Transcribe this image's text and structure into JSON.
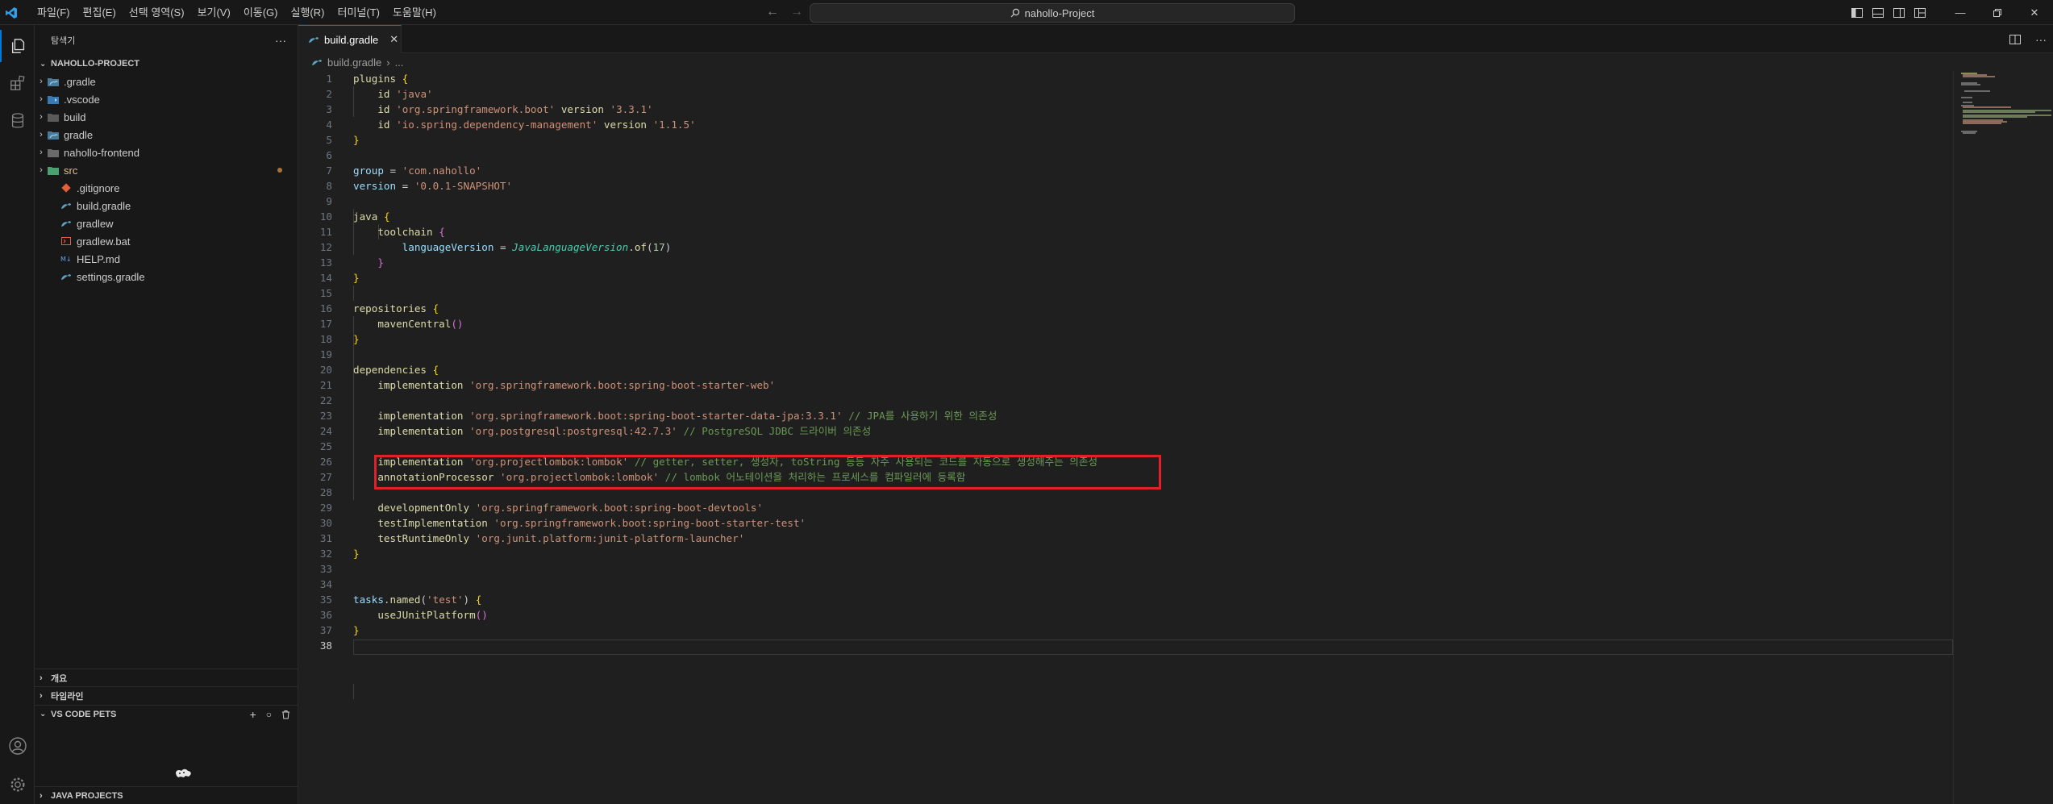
{
  "titlebar": {
    "menu": [
      "파일(F)",
      "편집(E)",
      "선택 영역(S)",
      "보기(V)",
      "이동(G)",
      "실행(R)",
      "터미널(T)",
      "도움말(H)"
    ],
    "search": "nahollo-Project"
  },
  "sidebar": {
    "header": "탐색기",
    "more": "···",
    "project": "NAHOLLO-PROJECT",
    "items": [
      {
        "label": ".gradle",
        "type": "folder",
        "icon": "gradle-folder-icon",
        "color": "#cccccc"
      },
      {
        "label": ".vscode",
        "type": "folder",
        "icon": "vscode-folder-icon",
        "color": "#cccccc"
      },
      {
        "label": "build",
        "type": "folder",
        "icon": "build-folder-icon",
        "color": "#cccccc"
      },
      {
        "label": "gradle",
        "type": "folder",
        "icon": "gradle-folder-icon",
        "color": "#cccccc"
      },
      {
        "label": "nahollo-frontend",
        "type": "folder",
        "icon": "folder-icon",
        "color": "#cccccc"
      },
      {
        "label": "src",
        "type": "folder",
        "icon": "src-folder-icon",
        "color": "#e2c08d"
      },
      {
        "label": ".gitignore",
        "type": "file",
        "icon": "git-icon",
        "color": "#cccccc"
      },
      {
        "label": "build.gradle",
        "type": "file",
        "icon": "gradle-icon",
        "color": "#cccccc"
      },
      {
        "label": "gradlew",
        "type": "file",
        "icon": "gradle-icon",
        "color": "#cccccc"
      },
      {
        "label": "gradlew.bat",
        "type": "file",
        "icon": "bat-icon",
        "color": "#cccccc"
      },
      {
        "label": "HELP.md",
        "type": "file",
        "icon": "markdown-icon",
        "color": "#cccccc"
      },
      {
        "label": "settings.gradle",
        "type": "file",
        "icon": "gradle-icon",
        "color": "#cccccc"
      }
    ],
    "panels": {
      "outline": "개요",
      "timeline": "타임라인",
      "pets": "VS CODE PETS",
      "java": "JAVA PROJECTS"
    }
  },
  "editor": {
    "tab": "build.gradle",
    "breadcrumb": [
      "build.gradle",
      "..."
    ],
    "highlight_color": "#e0202a"
  }
}
